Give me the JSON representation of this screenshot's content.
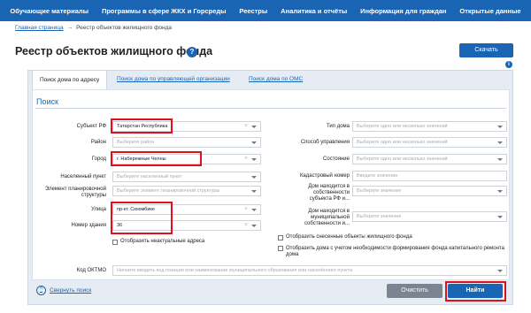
{
  "nav": {
    "items": [
      "Обучающие материалы",
      "Программы в сфере ЖКХ и Горсреды",
      "Реестры",
      "Аналитика и отчёты",
      "Информация для граждан",
      "Открытые данные"
    ]
  },
  "breadcrumb": {
    "home": "Главная страница",
    "separator": "→",
    "current": "Реестр объектов жилищного фонда"
  },
  "header": {
    "title": "Реестр объектов жилищного фонда",
    "help_icon": "?",
    "download_label": "Скачать",
    "info_icon": "i"
  },
  "tabs": [
    "Поиск дома по адресу",
    "Поиск дома по управляющей организации",
    "Поиск дома по ОМС"
  ],
  "search": {
    "title": "Поиск",
    "left": [
      {
        "label": "Субъект РФ",
        "value": "Татарстан Республика",
        "placeholder": ""
      },
      {
        "label": "Район",
        "value": "",
        "placeholder": "Выберите район"
      },
      {
        "label": "Город",
        "value": "г. Набережные Челны",
        "placeholder": ""
      },
      {
        "label": "Населенный пункт",
        "value": "",
        "placeholder": "Выберите населенный пункт"
      },
      {
        "label": "Элемент планировочной структуры",
        "value": "",
        "placeholder": "Выберите элемент планировочной структуры"
      },
      {
        "label": "Улица",
        "value": "пр-кт. Сююмбике",
        "placeholder": ""
      },
      {
        "label": "Номер здания",
        "value": "36",
        "placeholder": ""
      }
    ],
    "right": [
      {
        "label": "Тип дома",
        "placeholder": "Выберите одно или несколько значений"
      },
      {
        "label": "Способ управления",
        "placeholder": "Выберите одно или несколько значений"
      },
      {
        "label": "Состояние",
        "placeholder": "Выберите одно или несколько значений"
      },
      {
        "label": "Кадастровый номер",
        "placeholder": "Введите значение"
      },
      {
        "label": "Дом находится в собственности субъекта РФ и...",
        "placeholder": "Выберите значение"
      },
      {
        "label": "Дом находится в муниципальной собственности и...",
        "placeholder": "Выберите значение"
      }
    ],
    "check_emergency": "Отобразить неактуальные адреса",
    "check_demolished": "Отобразить снесенные объекты жилищного фонда",
    "check_capital": "Отобразить дома с учетом необходимости формирования фонда капитального ремонта дома",
    "oktmo_label": "Код ОКТМО",
    "oktmo_placeholder": "Начните вводить код позиции или наименование муниципального образования или населённого пункта",
    "collapse_label": "Свернуть поиск",
    "clear_label": "Очистить",
    "find_label": "Найти"
  },
  "colors": {
    "primary": "#1a65b3",
    "highlight": "#e0101c",
    "panel_bg": "#e6ecf4",
    "clear_btn": "#7b8591"
  },
  "icons": [
    "help-icon",
    "info-icon",
    "chevron-down-icon",
    "clear-x-icon",
    "chevron-up-circle-icon"
  ]
}
